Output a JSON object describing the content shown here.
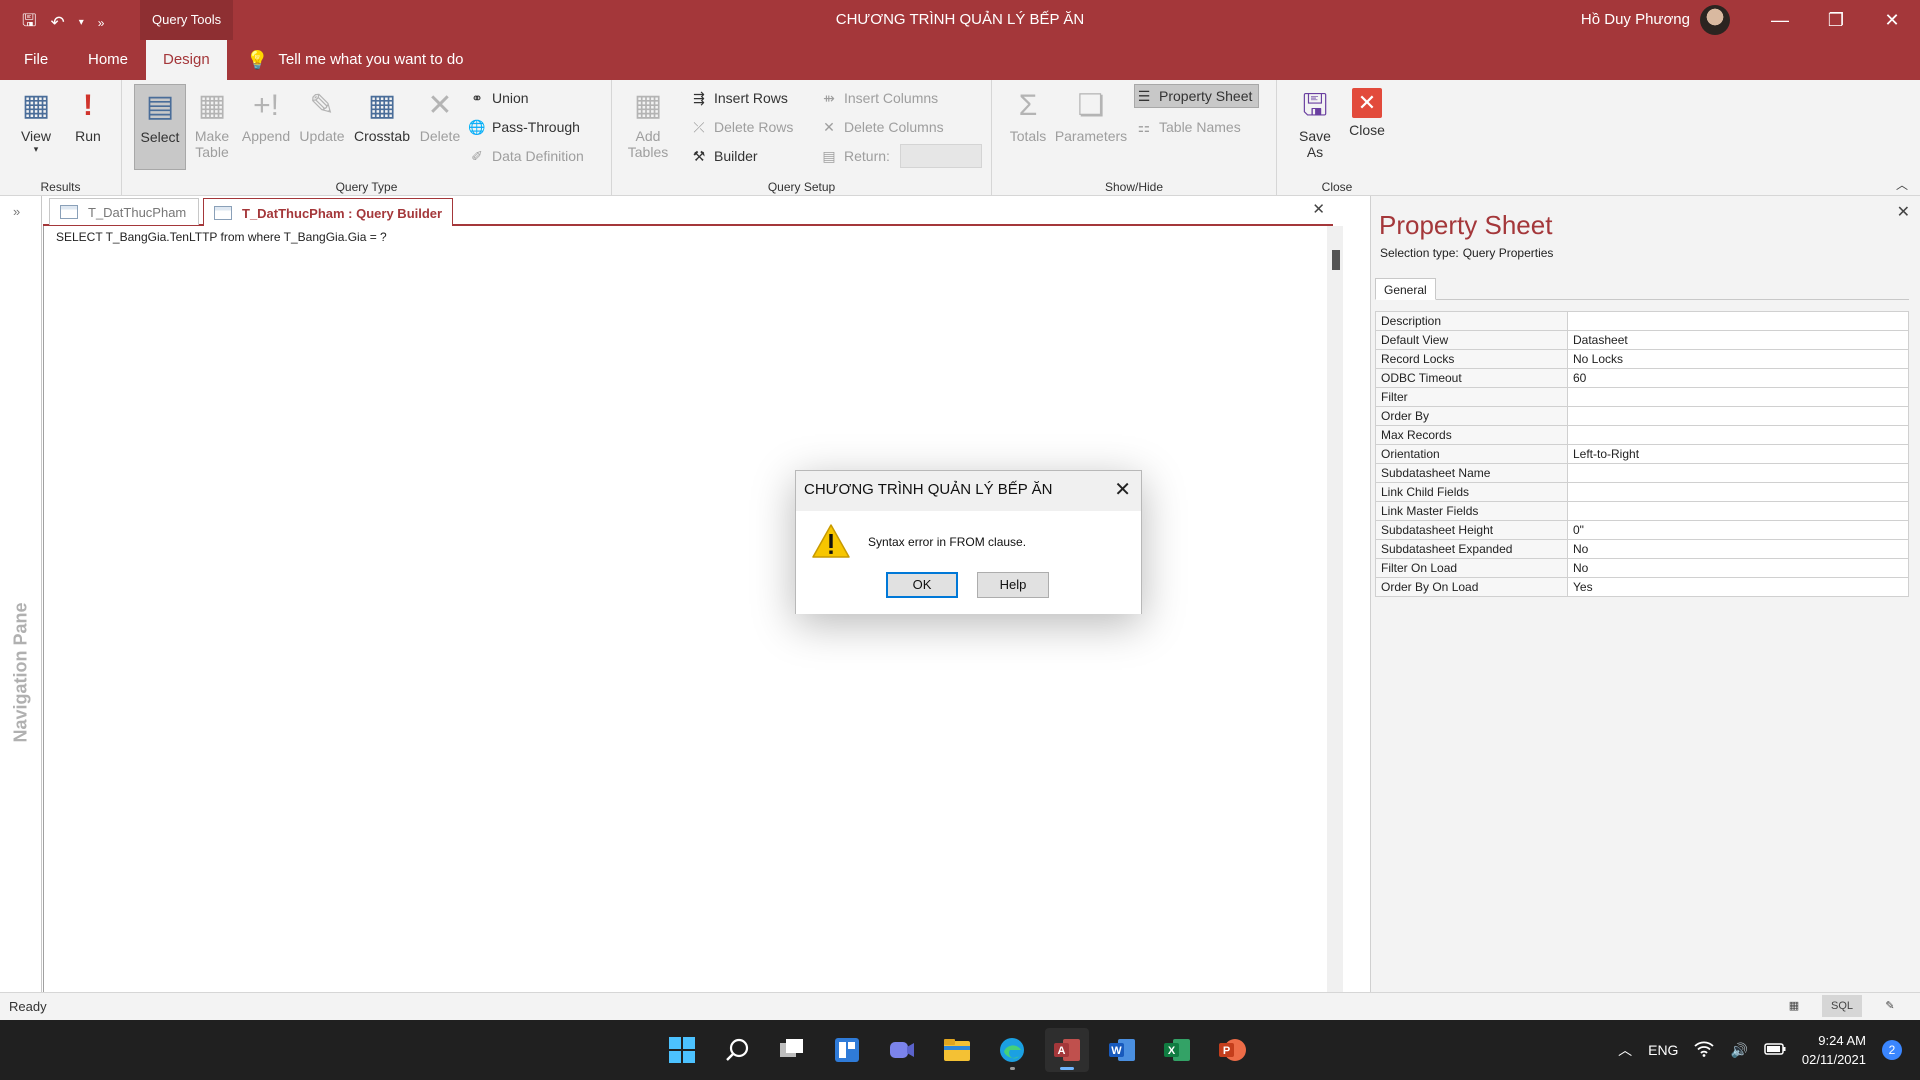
{
  "title_bar": {
    "query_tools": "Query Tools",
    "app_title": "CHƯƠNG TRÌNH QUẢN LÝ BẾP ĂN",
    "user_name": "Hồ Duy Phương"
  },
  "menu": {
    "file": "File",
    "home": "Home",
    "design": "Design",
    "tell_me": "Tell me what you want to do"
  },
  "ribbon": {
    "results": {
      "label": "Results",
      "view": "View",
      "run": "Run"
    },
    "query_type": {
      "label": "Query Type",
      "select": "Select",
      "make_table_1": "Make",
      "make_table_2": "Table",
      "append": "Append",
      "update": "Update",
      "crosstab": "Crosstab",
      "delete": "Delete",
      "union": "Union",
      "pass_through": "Pass-Through",
      "data_definition": "Data Definition"
    },
    "query_setup": {
      "label": "Query Setup",
      "add_tables_1": "Add",
      "add_tables_2": "Tables",
      "insert_rows": "Insert Rows",
      "delete_rows": "Delete Rows",
      "builder": "Builder",
      "insert_columns": "Insert Columns",
      "delete_columns": "Delete Columns",
      "return": "Return:"
    },
    "show_hide": {
      "label": "Show/Hide",
      "totals": "Totals",
      "parameters": "Parameters",
      "property_sheet": "Property Sheet",
      "table_names": "Table Names"
    },
    "close": {
      "label": "Close",
      "save_as_1": "Save",
      "save_as_2": "As",
      "close": "Close"
    }
  },
  "nav_pane": {
    "label": "Navigation Pane"
  },
  "doc_tabs": [
    {
      "label": "T_DatThucPham"
    },
    {
      "label": "T_DatThucPham : Query Builder"
    }
  ],
  "editor": {
    "sql": "SELECT T_BangGia.TenLTTP from where T_BangGia.Gia = ?"
  },
  "property_sheet": {
    "title": "Property Sheet",
    "selection_type_label": "Selection type:",
    "selection_type_value": "Query Properties",
    "tab_general": "General",
    "rows": [
      {
        "key": "Description",
        "value": ""
      },
      {
        "key": "Default View",
        "value": "Datasheet"
      },
      {
        "key": "Record Locks",
        "value": "No Locks"
      },
      {
        "key": "ODBC Timeout",
        "value": "60"
      },
      {
        "key": "Filter",
        "value": ""
      },
      {
        "key": "Order By",
        "value": ""
      },
      {
        "key": "Max Records",
        "value": ""
      },
      {
        "key": "Orientation",
        "value": "Left-to-Right"
      },
      {
        "key": "Subdatasheet Name",
        "value": ""
      },
      {
        "key": "Link Child Fields",
        "value": ""
      },
      {
        "key": "Link Master Fields",
        "value": ""
      },
      {
        "key": "Subdatasheet Height",
        "value": "0\""
      },
      {
        "key": "Subdatasheet Expanded",
        "value": "No"
      },
      {
        "key": "Filter On Load",
        "value": "No"
      },
      {
        "key": "Order By On Load",
        "value": "Yes"
      }
    ]
  },
  "dialog": {
    "title": "CHƯƠNG TRÌNH QUẢN LÝ BẾP ĂN",
    "message": "Syntax error in FROM clause.",
    "ok": "OK",
    "help": "Help"
  },
  "status_bar": {
    "text": "Ready",
    "sql_view": "SQL"
  },
  "taskbar": {
    "language": "ENG",
    "time": "9:24 AM",
    "date": "02/11/2021",
    "notification_count": "2",
    "icons": [
      "windows-start-icon",
      "search-icon",
      "task-view-icon",
      "widgets-icon",
      "teams-chat-icon",
      "file-explorer-icon",
      "edge-icon",
      "access-icon",
      "word-icon",
      "excel-icon",
      "powerpoint-icon"
    ]
  },
  "colors": {
    "accent": "#a4373a",
    "ribbon_bg": "#f3f3f3",
    "taskbar_bg": "#202020",
    "dialog_default_border": "#0078d7"
  }
}
